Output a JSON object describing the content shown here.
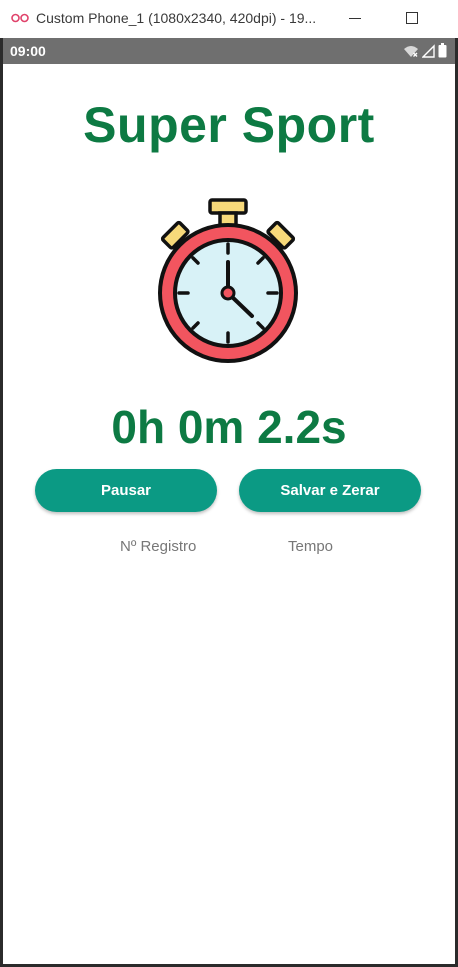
{
  "window": {
    "title": "Custom Phone_1 (1080x2340, 420dpi) - 19...",
    "minimize_icon": "minimize-icon",
    "maximize_icon": "maximize-icon"
  },
  "status_bar": {
    "time": "09:00",
    "icons": [
      "wifi-icon",
      "signal-icon",
      "battery-icon"
    ]
  },
  "app": {
    "title": "Super Sport",
    "stopwatch_icon": "stopwatch-icon",
    "timer": "0h 0m 2.2s",
    "buttons": {
      "pause_label": "Pausar",
      "save_reset_label": "Salvar e Zerar"
    },
    "table": {
      "headers": [
        "Nº Registro",
        "Tempo"
      ]
    }
  },
  "colors": {
    "title_green": "#0d7a43",
    "button_teal": "#0b9a84",
    "status_bar": "#6f6f6f"
  }
}
